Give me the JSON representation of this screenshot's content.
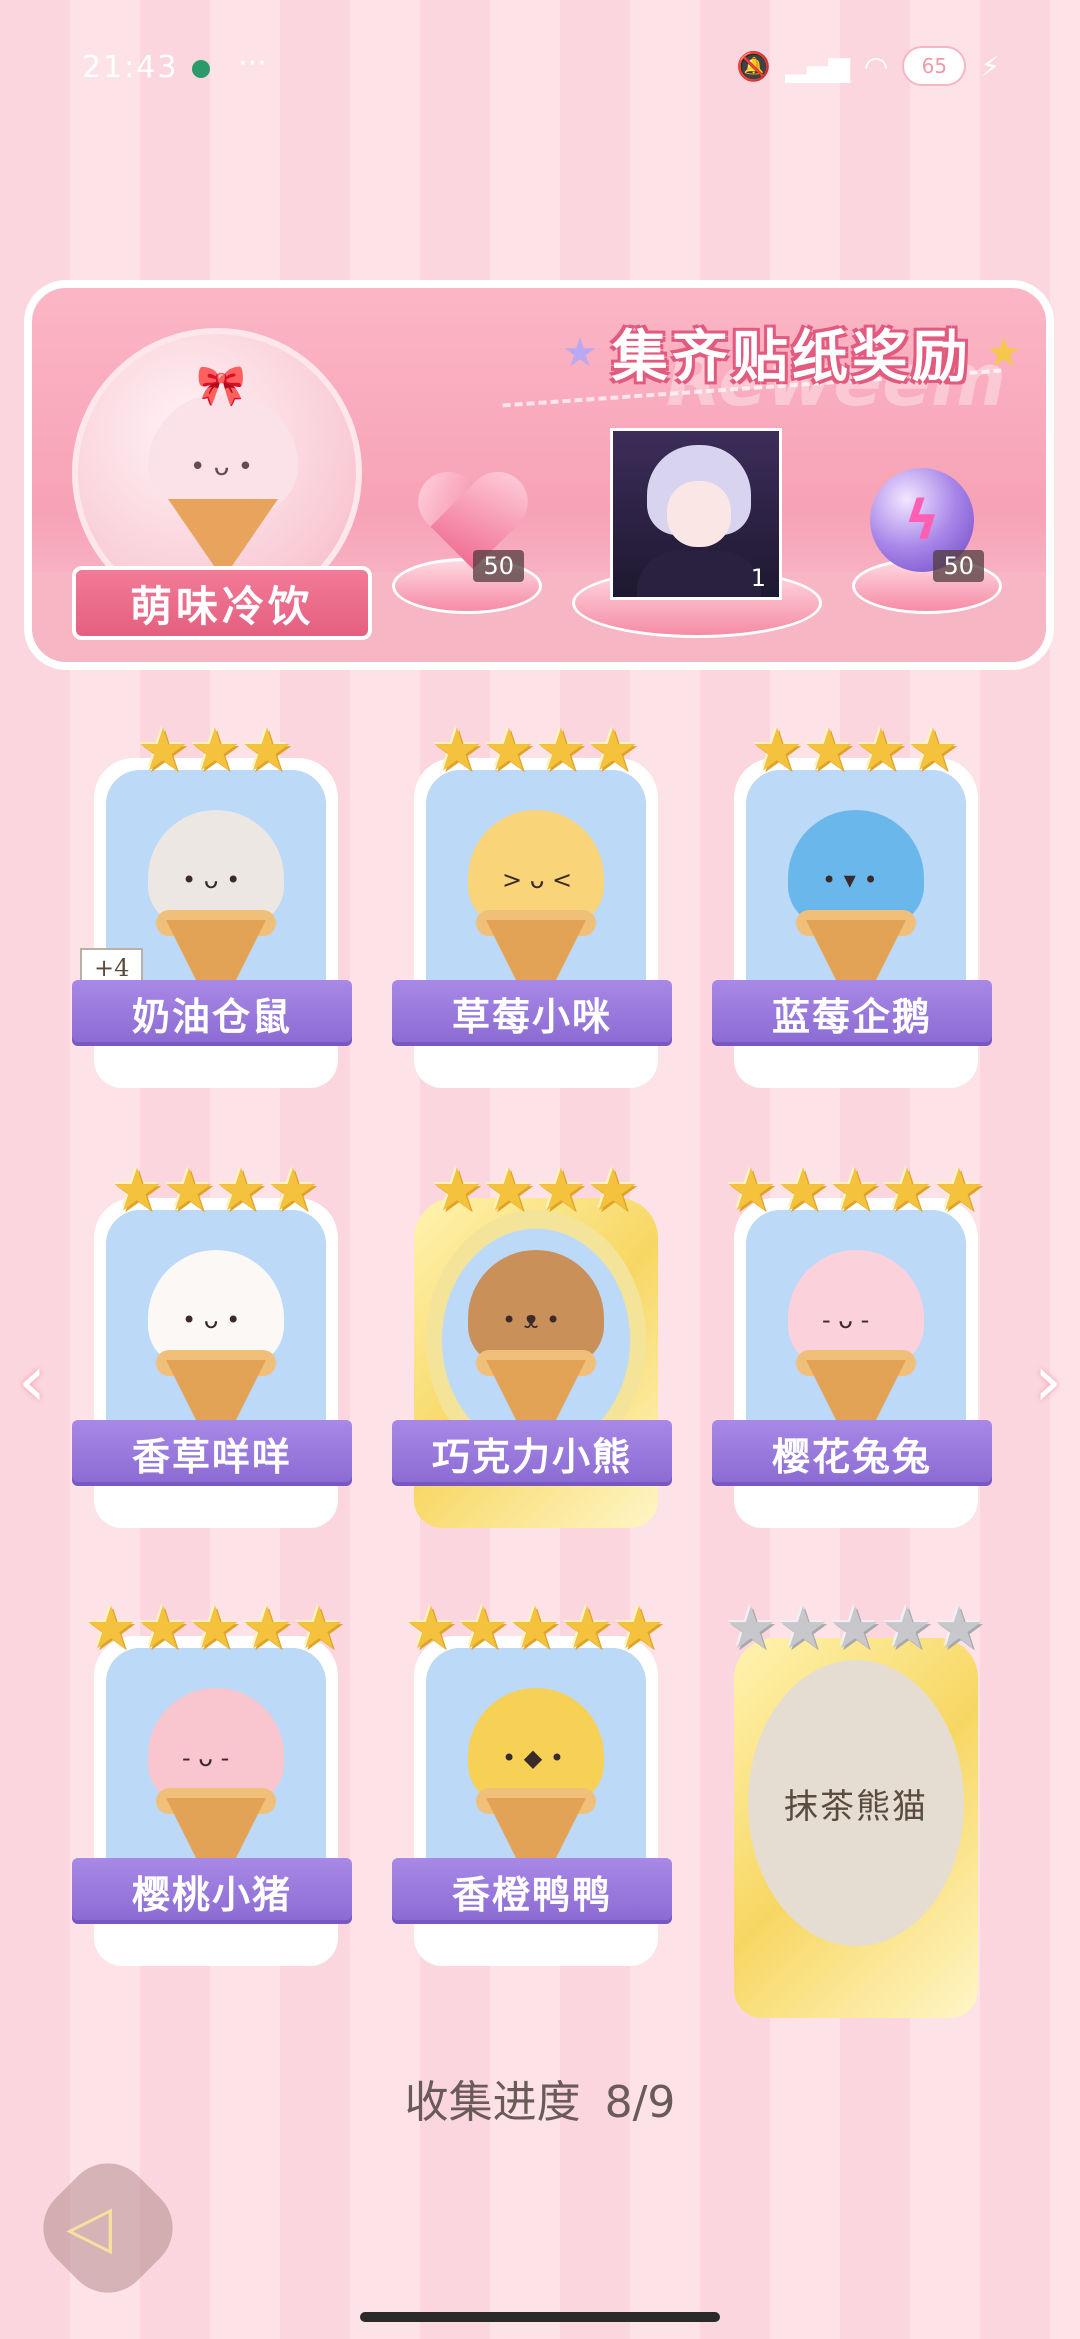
{
  "status_bar": {
    "time": "21:43",
    "more": "···",
    "battery": "65"
  },
  "banner": {
    "title": "集齐贴纸奖励",
    "set_name": "萌味冷饮",
    "watermark": "Reweem",
    "rewards": [
      {
        "icon": "pink-heart-gem-icon",
        "count": "50"
      },
      {
        "icon": "character-portrait",
        "count": "1"
      },
      {
        "icon": "purple-lightning-orb-icon",
        "count": "50"
      }
    ]
  },
  "cards": [
    {
      "name": "奶油仓鼠",
      "stars": 3,
      "badge": "+4",
      "color": "#ece7e2"
    },
    {
      "name": "草莓小咪",
      "stars": 4,
      "color": "#f9d478"
    },
    {
      "name": "蓝莓企鹅",
      "stars": 4,
      "color": "#6ab7ec"
    },
    {
      "name": "香草咩咩",
      "stars": 4,
      "color": "#fbf8f6"
    },
    {
      "name": "巧克力小熊",
      "stars": 4,
      "color": "#c9905a"
    },
    {
      "name": "樱花兔兔",
      "stars": 5,
      "color": "#fbd2dc"
    },
    {
      "name": "樱桃小猪",
      "stars": 5,
      "color": "#f9c6cf"
    },
    {
      "name": "香橙鸭鸭",
      "stars": 5,
      "color": "#f7d155"
    },
    {
      "name": "抹茶熊猫",
      "stars": 5,
      "locked": true
    }
  ],
  "progress": {
    "label": "收集进度",
    "value": "8/9"
  },
  "colors": {
    "accent_purple": "#8a6ad2",
    "banner_pink": "#f7a2b6",
    "star_gold": "#f4c23c"
  }
}
